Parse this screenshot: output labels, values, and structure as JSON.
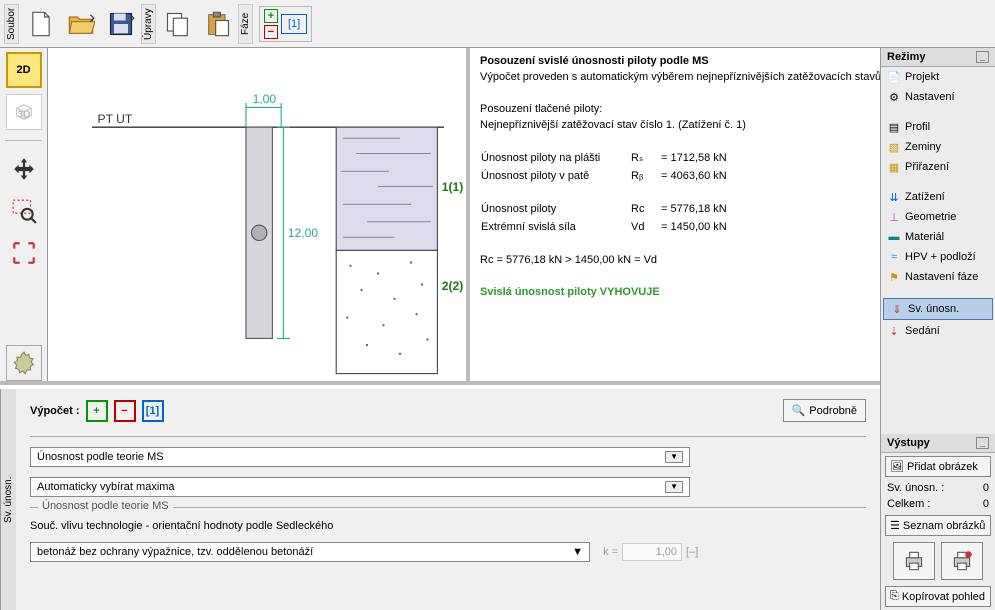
{
  "toolbar": {
    "soubor_label": "Soubor",
    "upravy_label": "Úpravy",
    "faze_label": "Fáze",
    "faze_num": "[1]"
  },
  "view": {
    "btn2d": "2D",
    "btn3d": "3D"
  },
  "drawing": {
    "pt_ut": "PT UT",
    "dim_top": "1,00",
    "dim_depth": "12,00",
    "layer1": "1(1)",
    "layer2": "2(2)"
  },
  "report": {
    "title": "Posouzení svislé únosnosti piloty podle MS",
    "sub": "Výpočet proveden s automatickým výběrem nejnepříznivějších zatěžovacích stavů.",
    "sec1": "Posouzení tlačené piloty:",
    "sec1b": "Nejnepříznivější zatěžovací stav číslo 1. (Zatížení č. 1)",
    "r_shaft_l": "Únosnost piloty na plášti",
    "r_shaft_s": "Rₛ",
    "r_shaft_v": "= 1712,58 kN",
    "r_base_l": "Únosnost piloty v patě",
    "r_base_s": "Rᵦ",
    "r_base_v": "= 4063,60 kN",
    "r_tot_l": "Únosnost piloty",
    "r_tot_s": "Rc",
    "r_tot_v": "= 5776,18 kN",
    "vd_l": "Extrémní svislá síla",
    "vd_s": "Vd",
    "vd_v": "= 1450,00 kN",
    "compare": "Rc = 5776,18 kN > 1450,00 kN = Vd",
    "verdict": "Svislá únosnost piloty VYHOVUJE"
  },
  "modes": {
    "header": "Režimy",
    "items": [
      "Projekt",
      "Nastavení",
      "Profil",
      "Zeminy",
      "Přiřazení",
      "Zatížení",
      "Geometrie",
      "Materiál",
      "HPV + podloží",
      "Nastavení fáze",
      "Sv. únosn.",
      "Sedání"
    ]
  },
  "outputs": {
    "header": "Výstupy",
    "add_pic": "Přidat obrázek",
    "row1_l": "Sv. únosn. :",
    "row1_v": "0",
    "row2_l": "Celkem :",
    "row2_v": "0",
    "list_pic": "Seznam obrázků",
    "copy_view": "Kopírovat pohled"
  },
  "bottom": {
    "side_tab": "Sv. únosn.",
    "vypocet": "Výpočet :",
    "vyp_num": "[1]",
    "podrobne": "Podrobně",
    "sel1": "Únosnost podle teorie MS",
    "sel2": "Automaticky vybírat maxima",
    "group": "Únosnost podle teorie MS",
    "tech_label": "Souč. vlivu technologie - orientační hodnoty podle Sedleckého",
    "sel3": "betonáž bez ochrany výpažnice, tzv. oddělenou betonáží",
    "k_label": "k =",
    "k_val": "1,00",
    "k_unit": "[–]"
  }
}
